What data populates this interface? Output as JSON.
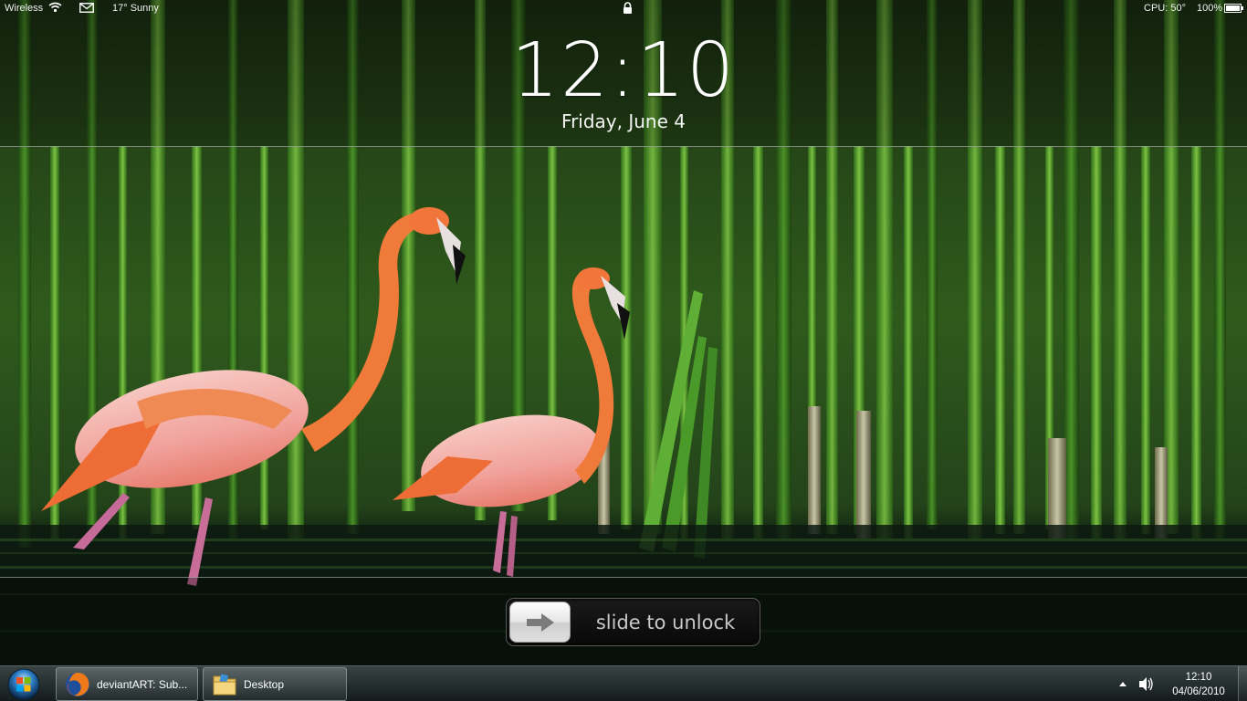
{
  "status_bar": {
    "network_label": "Wireless",
    "weather": "17°  Sunny",
    "cpu": "CPU: 50°",
    "battery": "100%"
  },
  "lockscreen": {
    "time": "12:10",
    "date": "Friday, June 4",
    "unlock_label": "slide to unlock"
  },
  "taskbar": {
    "buttons": [
      {
        "label": "deviantART: Sub...",
        "icon": "firefox-icon"
      },
      {
        "label": "Desktop",
        "icon": "folder-icon"
      }
    ],
    "clock_time": "12:10",
    "clock_date": "04/06/2010"
  },
  "colors": {
    "flamingo": "#f0703a",
    "flamingo_pink": "#f4b2b0",
    "reeds": "#3f8a24",
    "water": "#0d1a10"
  }
}
